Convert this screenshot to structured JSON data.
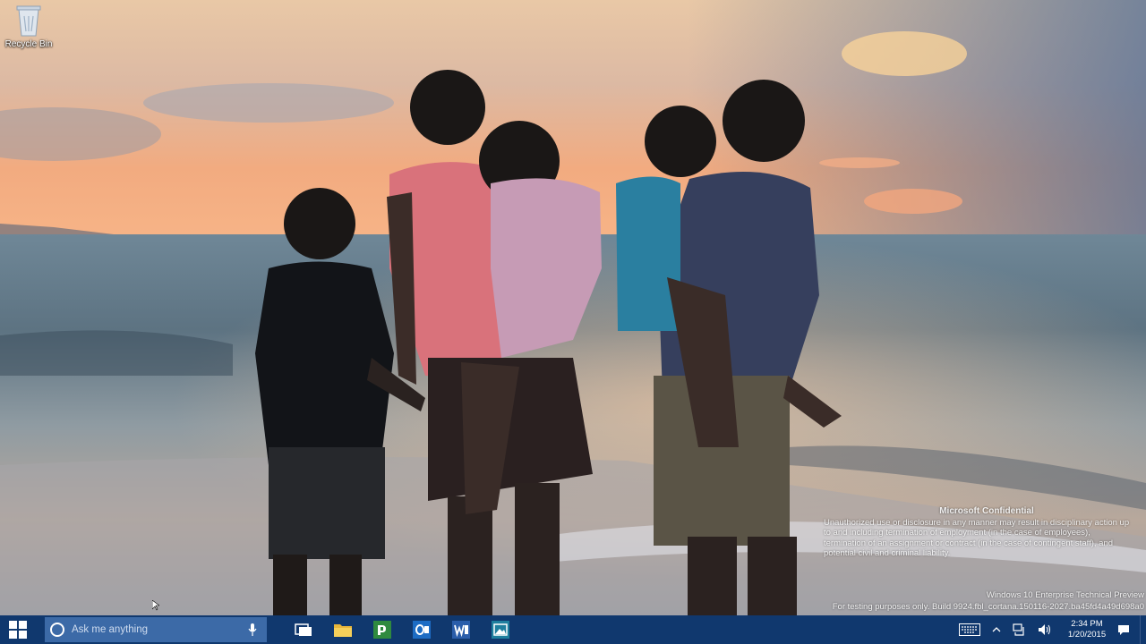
{
  "desktop": {
    "icons": [
      {
        "label": "Recycle Bin",
        "icon": "recycle-bin-icon"
      }
    ],
    "watermark": {
      "title": "Microsoft Confidential",
      "lines": [
        "Unauthorized use or disclosure in any manner may result in disciplinary action up",
        "to and including termination of employment (in the case of employees),",
        "termination of an assignment or contract (in the case of contingent staff), and",
        "potential civil and criminal liability."
      ],
      "edition": "Windows 10 Enterprise Technical Preview",
      "build": "For testing purposes only. Build 9924.fbl_cortana.150116-2027.ba45fd4a49d698a0"
    }
  },
  "taskbar": {
    "color": "#10386e",
    "search_color": "#3c6aa7",
    "search": {
      "placeholder": "Ask me anything"
    },
    "pinned": [
      {
        "name": "task-view",
        "icon": "task-view-icon"
      },
      {
        "name": "file-explorer",
        "icon": "folder-icon"
      },
      {
        "name": "project",
        "icon": "project-icon"
      },
      {
        "name": "outlook",
        "icon": "outlook-icon"
      },
      {
        "name": "word",
        "icon": "word-icon"
      },
      {
        "name": "photos",
        "icon": "photos-icon"
      }
    ],
    "tray": {
      "icons": [
        "keyboard-icon",
        "chevron-up-icon",
        "network-icon",
        "volume-icon"
      ],
      "time": "2:34 PM",
      "date": "1/20/2015"
    }
  }
}
